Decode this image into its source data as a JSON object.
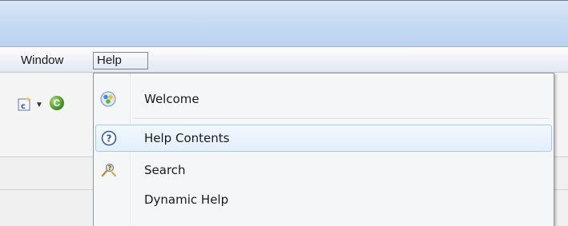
{
  "menubar": {
    "items": [
      {
        "label": "Window"
      },
      {
        "label": "Help"
      }
    ]
  },
  "toolbar": {
    "icons": [
      "new-class-wizard-icon",
      "dropdown-arrow-icon",
      "run-green-icon"
    ]
  },
  "help_menu": {
    "items": [
      {
        "label": "Welcome",
        "icon": "welcome-globe-icon"
      },
      {
        "label": "Help Contents",
        "icon": "help-question-icon"
      },
      {
        "label": "Search",
        "icon": "search-key-icon"
      },
      {
        "label": "Dynamic Help",
        "icon": ""
      }
    ],
    "highlighted": "Help Contents"
  },
  "colors": {
    "titlebar": "#c7dbf3",
    "highlight_border": "#a8c8ec",
    "highlight_fill": "#e3effc",
    "menu_bg": "#f5f6f7"
  }
}
